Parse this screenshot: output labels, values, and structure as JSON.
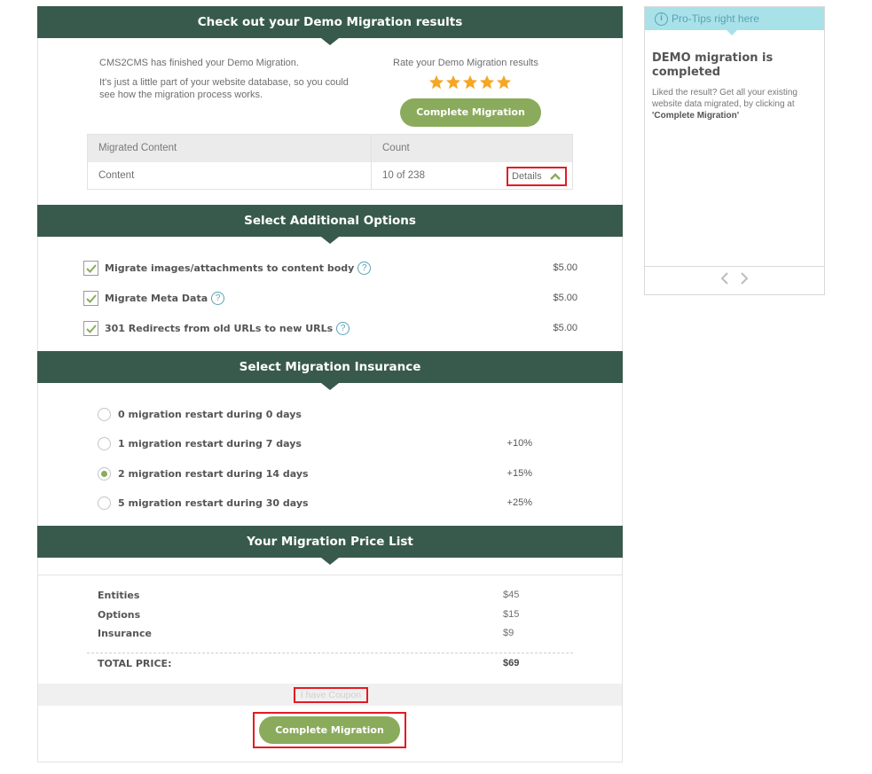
{
  "results": {
    "title": "Check out your Demo Migration results",
    "intro_line1": "CMS2CMS has finished your Demo Migration.",
    "intro_line2": "It's just a little part of your website database, so you could see how the migration process works.",
    "rate_label": "Rate your Demo Migration results",
    "stars": 5,
    "complete_button": "Complete Migration",
    "table": {
      "col_content": "Migrated Content",
      "col_count": "Count",
      "row_name": "Content",
      "row_count": "10 of 238",
      "details_link": "Details"
    }
  },
  "options": {
    "title": "Select Additional Options",
    "items": [
      {
        "label": "Migrate images/attachments to content body",
        "price": "$5.00",
        "checked": true
      },
      {
        "label": "Migrate Meta Data",
        "price": "$5.00",
        "checked": true
      },
      {
        "label": "301 Redirects from old URLs to new URLs",
        "price": "$5.00",
        "checked": true
      }
    ],
    "help_glyph": "?"
  },
  "insurance": {
    "title": "Select Migration Insurance",
    "items": [
      {
        "label": "0 migration restart during 0 days",
        "pct": "",
        "selected": false
      },
      {
        "label": "1 migration restart during 7 days",
        "pct": "+10%",
        "selected": false
      },
      {
        "label": "2 migration restart during 14 days",
        "pct": "+15%",
        "selected": true
      },
      {
        "label": "5 migration restart during 30 days",
        "pct": "+25%",
        "selected": false
      }
    ]
  },
  "prices": {
    "title": "Your Migration Price List",
    "entities_label": "Entities",
    "entities_value": "$45",
    "options_label": "Options",
    "options_value": "$15",
    "insurance_label": "Insurance",
    "insurance_value": "$9",
    "total_label": "TOTAL PRICE:",
    "total_value": "$69",
    "coupon_link": "I have Coupon",
    "complete_button": "Complete Migration"
  },
  "tips": {
    "header": "Pro-Tips right here",
    "info_glyph": "i",
    "title": "DEMO migration is completed",
    "text_prefix": "Liked the result? Get all your existing website data migrated, by clicking at ",
    "text_bold": "'Complete Migration'"
  },
  "colors": {
    "header_bg": "#385a4d",
    "accent_green": "#8bab5c",
    "star": "#f5a623",
    "highlight_red": "#e31b23",
    "tips_header_bg": "#a8e2e8",
    "tips_accent": "#5aa1b6"
  }
}
